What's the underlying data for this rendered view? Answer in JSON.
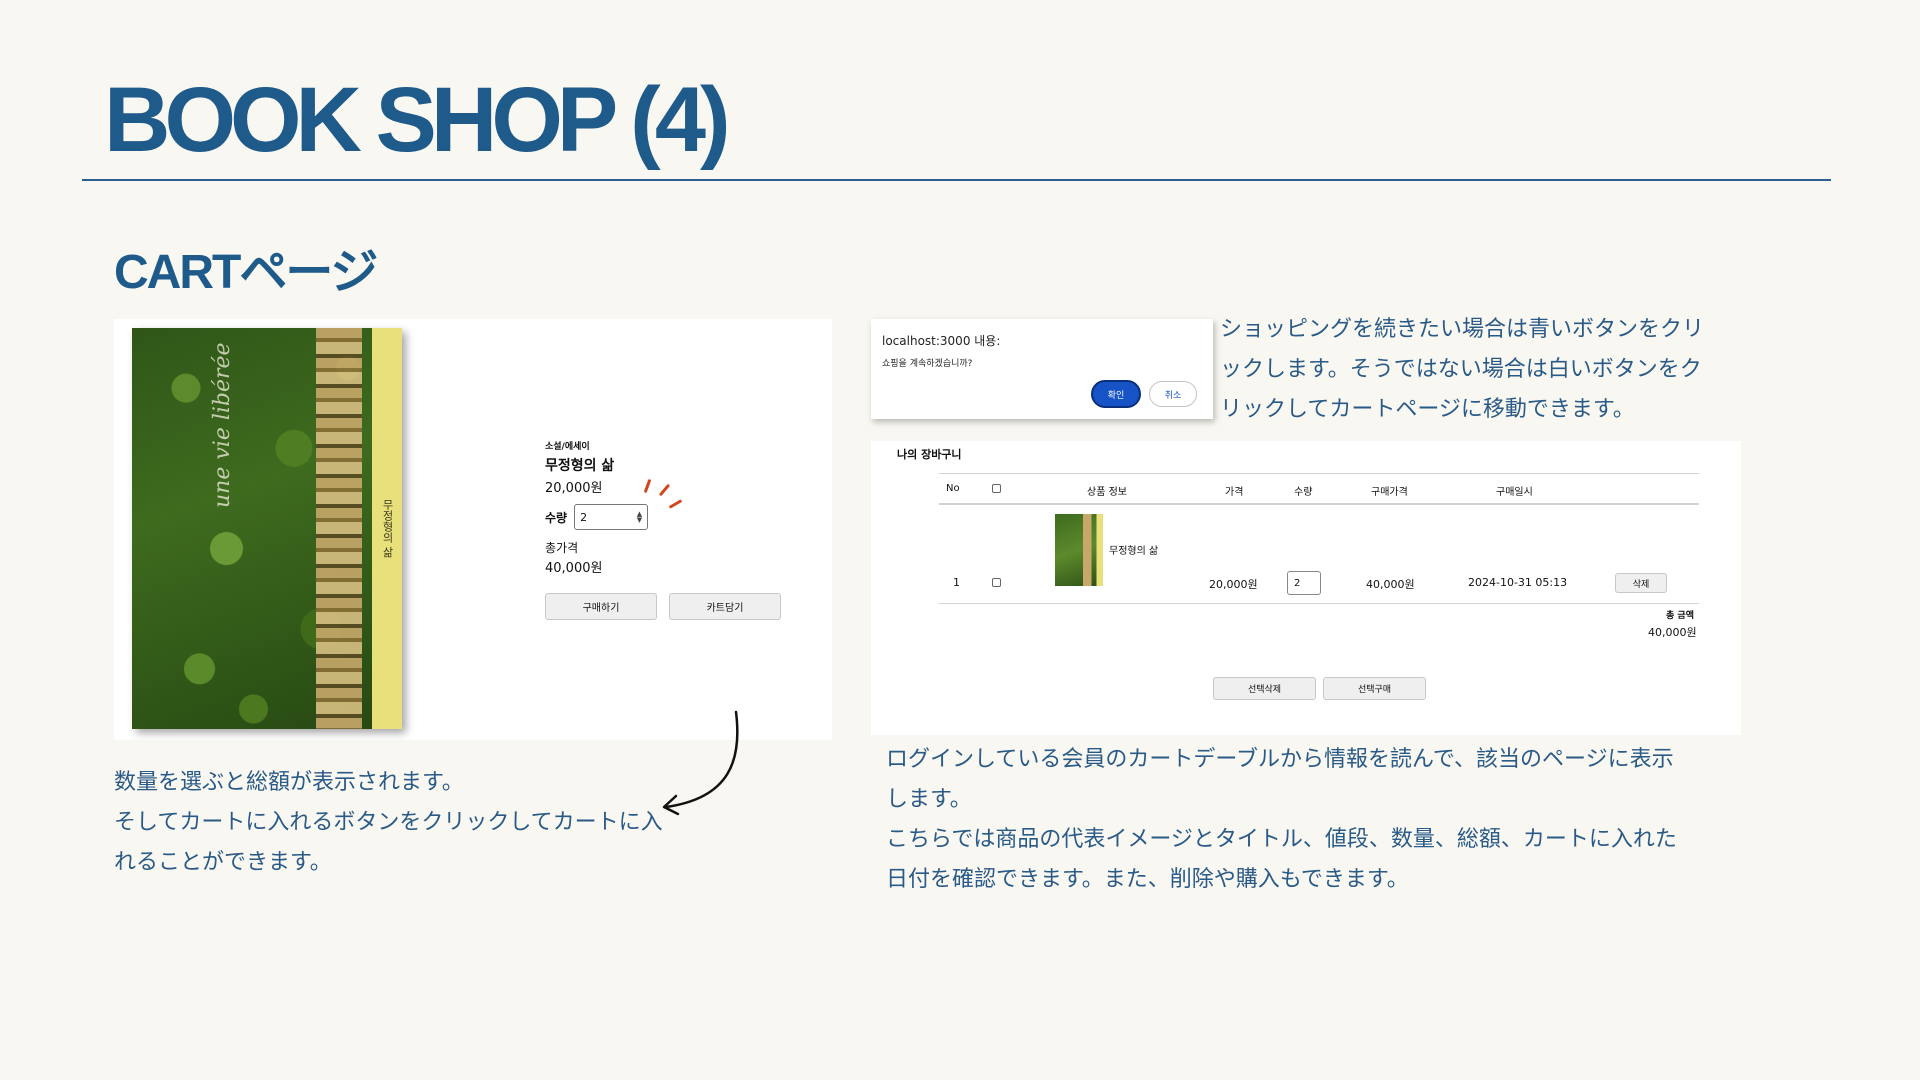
{
  "slide": {
    "title": "BOOK SHOP (4)",
    "subtitle": "CARTページ",
    "desc_left": [
      "数量を選ぶと総額が表示されます。",
      "そしてカートに入れるボタンをクリックしてカートに入",
      "れることができます。"
    ],
    "desc_dialog": [
      "ショッピングを続きたい場合は青いボタンをクリ",
      "ックします。そうではない場合は白いボタンをク",
      "リックしてカートページに移動できます。"
    ],
    "desc_cart": [
      "ログインしている会員のカートデーブルから情報を読んで、該当のページに表示",
      "します。",
      "こちらでは商品の代表イメージとタイトル、値段、数量、総額、カートに入れた",
      "日付を確認できます。また、削除や購入もできます。"
    ]
  },
  "product": {
    "cover_script": "une vie libérée",
    "cover_spine": "무정형의 삶",
    "category": "소설/에세이",
    "name": "무정형의 삶",
    "price": "20,000원",
    "qty_label": "수량",
    "qty_value": "2",
    "total_label": "총가격",
    "total_value": "40,000원",
    "buy_button": "구매하기",
    "cart_button": "카트담기"
  },
  "dialog": {
    "title": "localhost:3000 내용:",
    "message": "쇼핑을 계속하겠습니까?",
    "ok": "확인",
    "cancel": "취소",
    "ok_color": "#1553c6"
  },
  "cart": {
    "title": "나의 장바구니",
    "headers": [
      "No",
      "상품 정보",
      "가격",
      "수량",
      "구매가격",
      "구매일시"
    ],
    "row": {
      "no": "1",
      "name": "무정형의 삶",
      "price": "20,000원",
      "qty": "2",
      "total": "40,000원",
      "date": "2024-10-31 05:13",
      "delete": "삭제"
    },
    "sum_label": "총 금액",
    "sum_value": "40,000원",
    "delete_selected": "선택삭제",
    "buy_selected": "선택구매"
  },
  "colors": {
    "title": "#1e5a8a",
    "background": "#f8f7f1",
    "text": "#2a5a87"
  }
}
